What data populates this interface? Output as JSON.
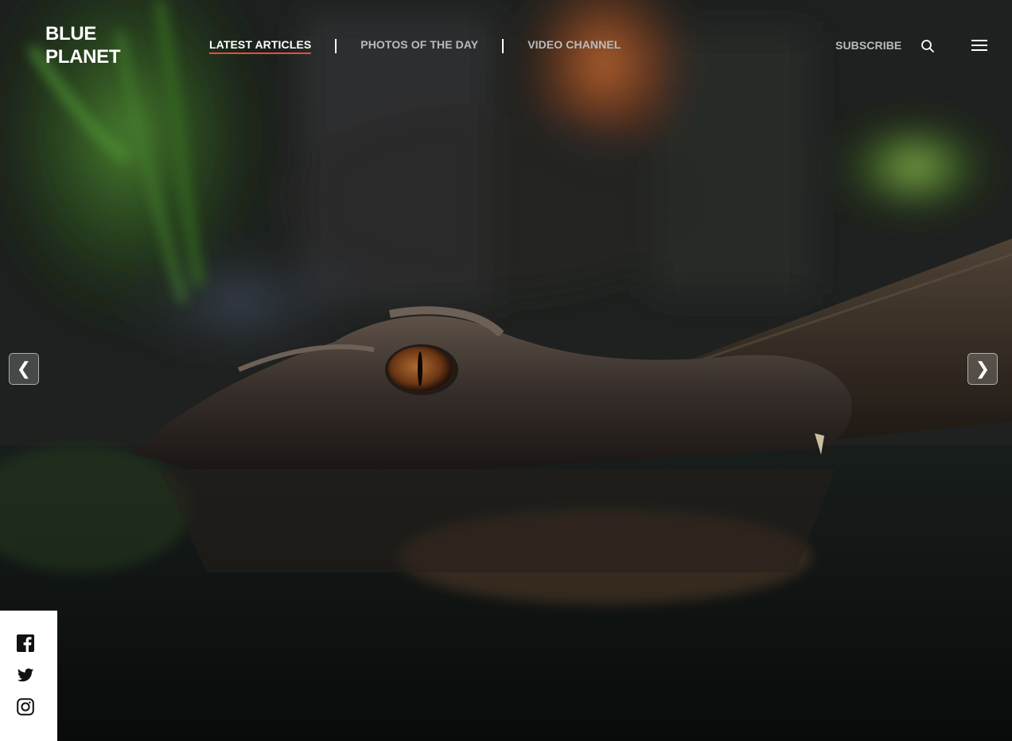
{
  "brand": {
    "line1": "BLUE",
    "line2": "PLANET"
  },
  "nav": {
    "items": [
      {
        "label": "LATEST ARTICLES",
        "active": true
      },
      {
        "label": "PHOTOS OF THE DAY",
        "active": false
      },
      {
        "label": "VIDEO CHANNEL",
        "active": false
      }
    ]
  },
  "header": {
    "subscribe_label": "SUBSCRIBE",
    "search_icon": "search-icon",
    "menu_icon": "hamburger-menu-icon"
  },
  "slider": {
    "prev_glyph": "❮",
    "next_glyph": "❯",
    "image_subject": "crocodile-in-water"
  },
  "social": {
    "icons": [
      "facebook-icon",
      "twitter-icon",
      "instagram-icon"
    ]
  },
  "colors": {
    "accent_underline": "#e0513f",
    "nav_inactive": "#b9bcbc",
    "nav_active": "#ffffff"
  }
}
